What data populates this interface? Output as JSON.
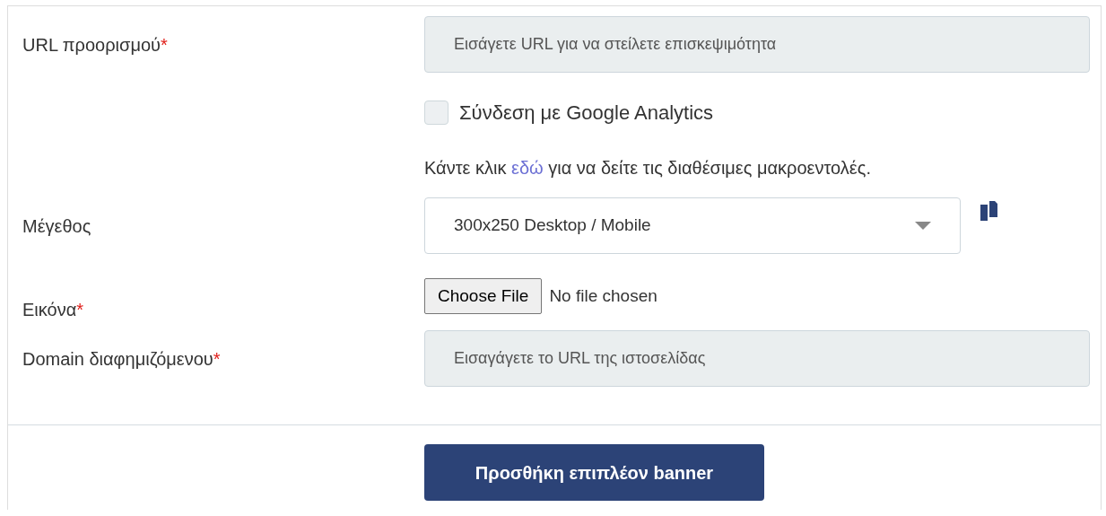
{
  "url_field": {
    "label": "URL προορισμού",
    "required_mark": "*",
    "placeholder": "Εισάγετε URL για να στείλετε επισκεψιμότητα"
  },
  "analytics_checkbox": {
    "label": "Σύνδεση με Google Analytics",
    "checked": false
  },
  "macros_help": {
    "before": "Κάντε κλικ",
    "link": "εδώ",
    "after": "για να δείτε τις διαθέσιμες μακροεντολές."
  },
  "size_select": {
    "label": "Μέγεθος",
    "value": "300x250 Desktop / Mobile"
  },
  "image_field": {
    "label": "Εικόνα",
    "required_mark": "*",
    "button": "Choose File",
    "status": "No file chosen"
  },
  "domain_field": {
    "label": "Domain διαφημιζόμενου",
    "required_mark": "*",
    "placeholder": "Εισαγάγετε το URL της ιστοσελίδας"
  },
  "add_button": "Προσθήκη επιπλέον banner"
}
